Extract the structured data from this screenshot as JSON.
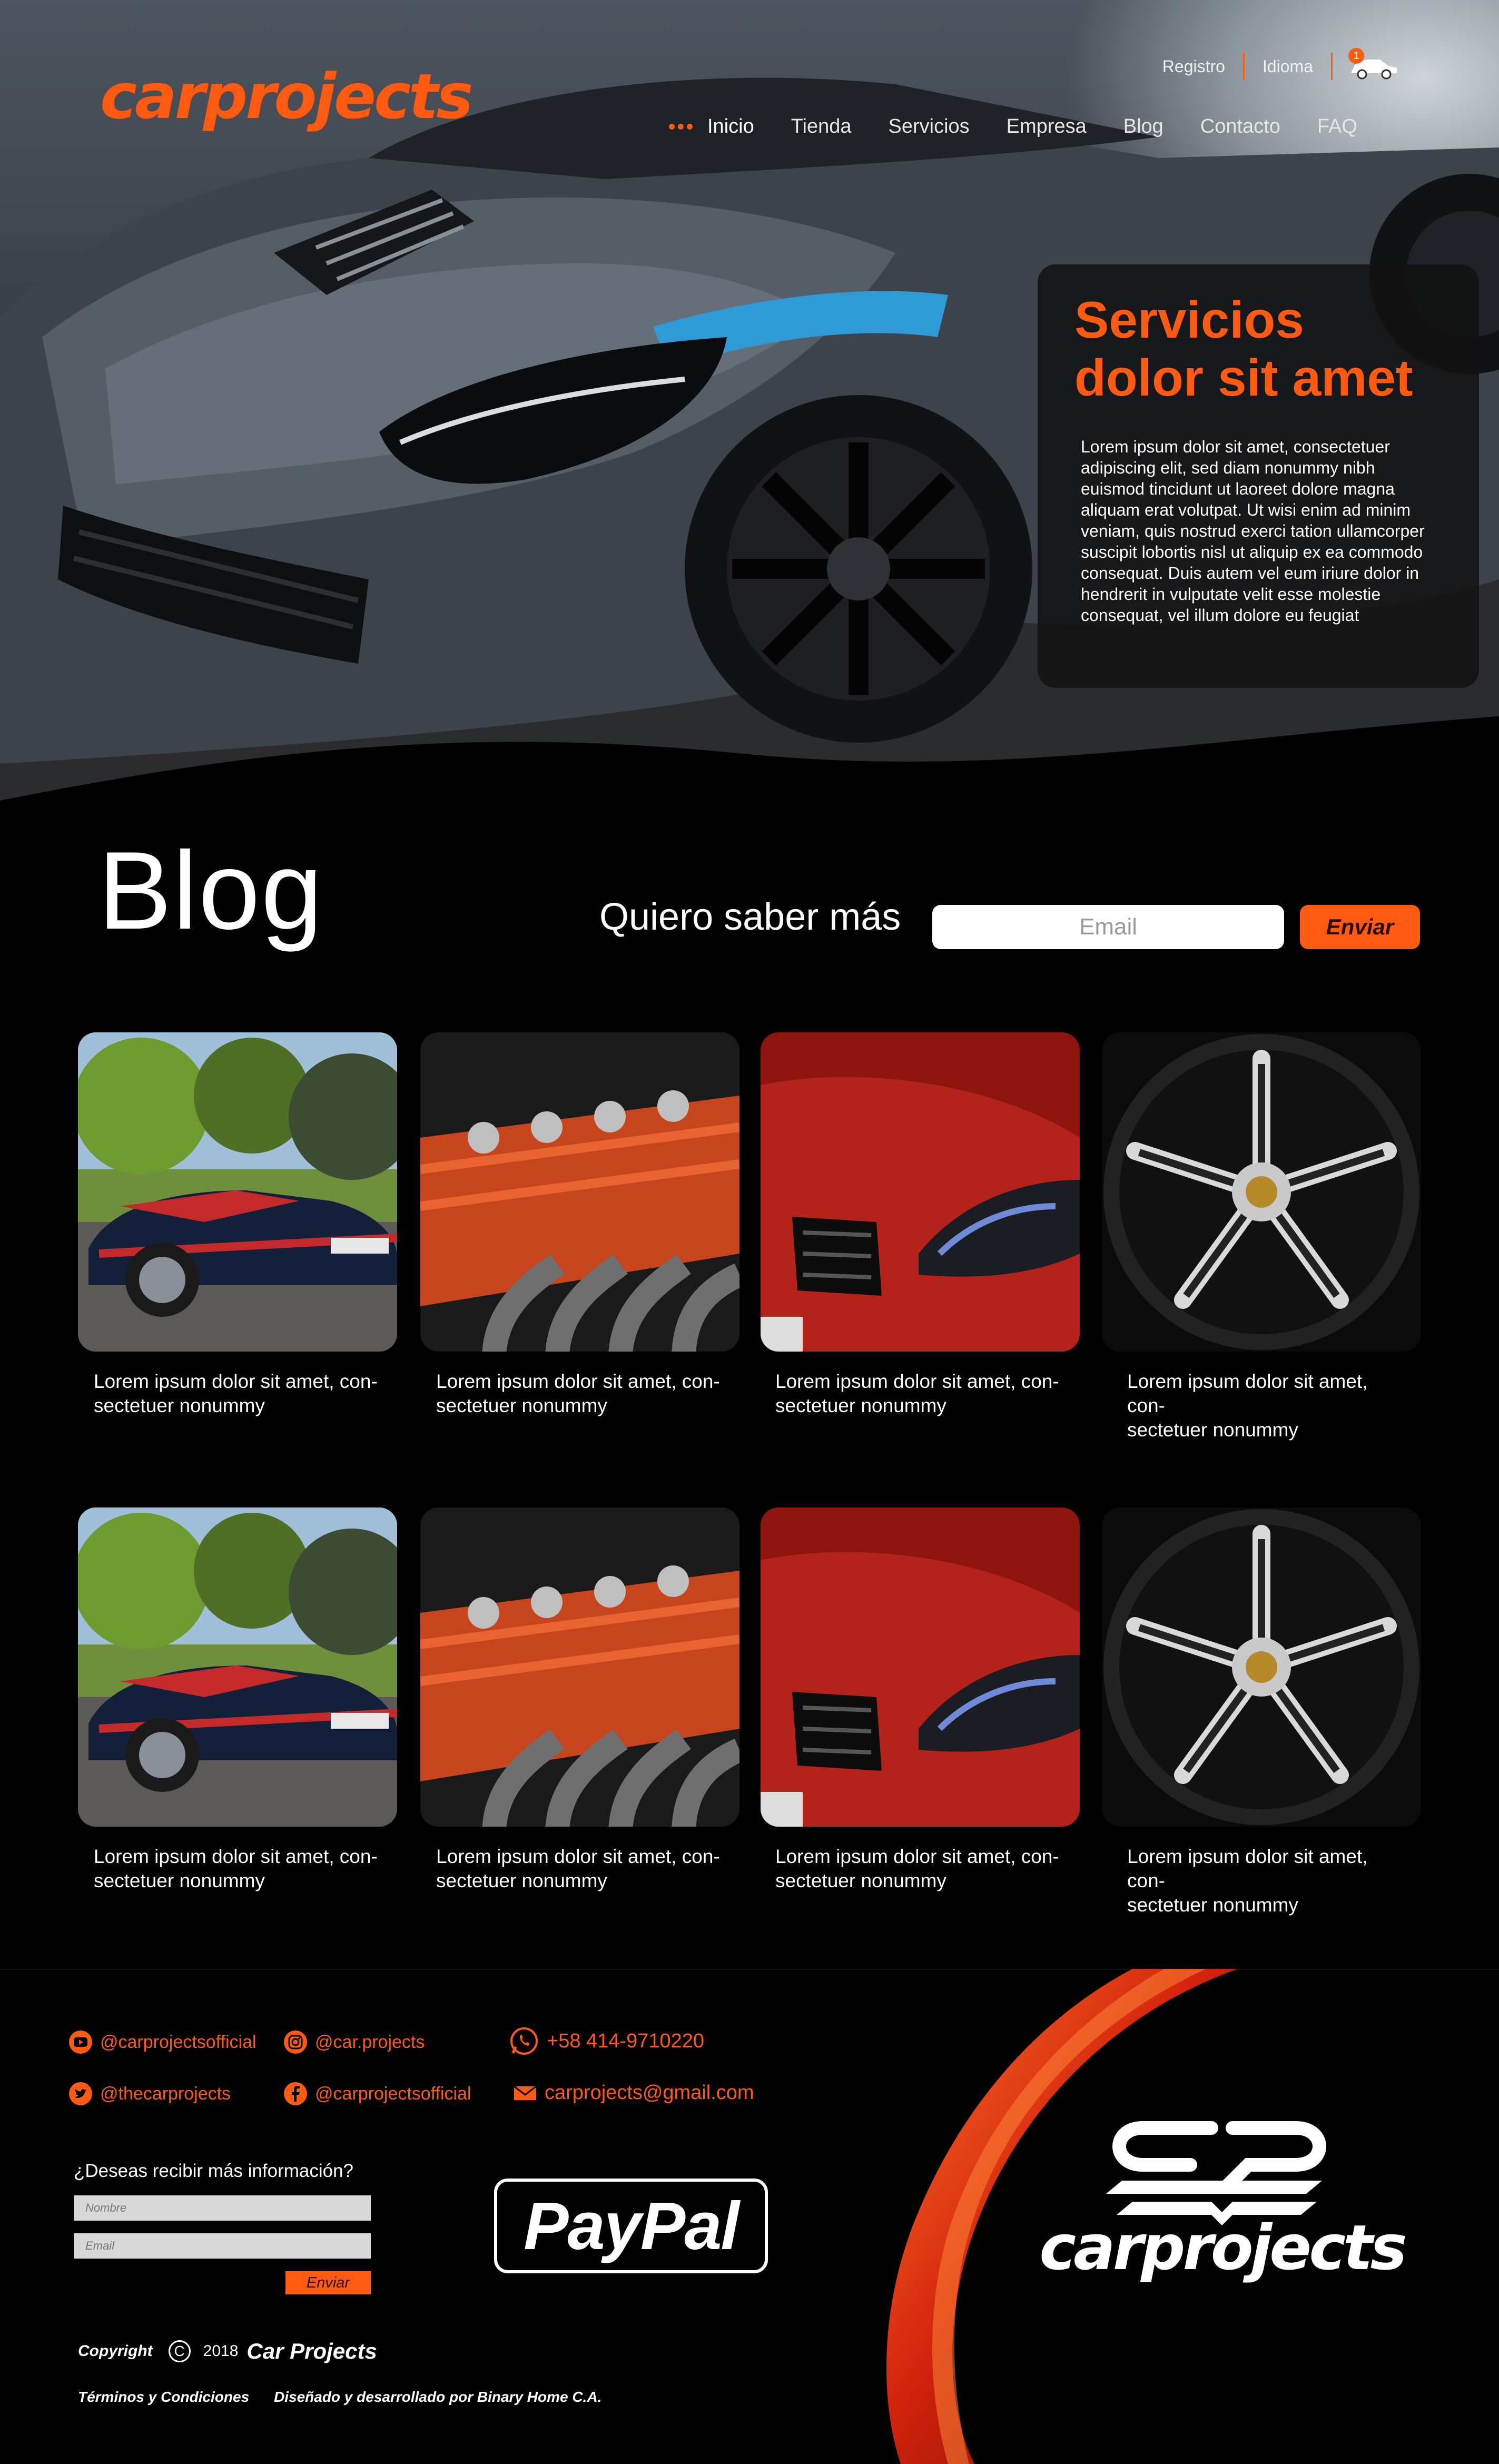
{
  "brand": {
    "logo_text": "carprojects",
    "accent_color": "#ff5a12",
    "background_color": "#000000"
  },
  "top_bar": {
    "links": [
      "Registro",
      "Idioma"
    ],
    "cart_count": "1",
    "cart_icon": "car-cart-icon"
  },
  "nav": {
    "items": [
      "Inicio",
      "Tienda",
      "Servicios",
      "Empresa",
      "Blog",
      "Contacto",
      "FAQ"
    ],
    "active": "Inicio"
  },
  "hero": {
    "title_line1": "Servicios",
    "title_line2": "dolor sit amet",
    "body": "Lorem ipsum dolor sit amet, consectetuer adipiscing elit, sed diam nonummy nibh euismod tincidunt ut laoreet dolore magna aliquam erat volutpat. Ut wisi enim ad minim veniam, quis nostrud exerci tation ullamcorper suscipit lobortis nisl ut aliquip ex ea commodo consequat. Duis autem vel eum iriure dolor in hendrerit in vulputate velit esse molestie consequat, vel illum dolore eu feugiat"
  },
  "blog": {
    "title": "Blog",
    "subscribe_label": "Quiero saber más",
    "email_placeholder": "Email",
    "send_label": "Enviar",
    "posts": [
      {
        "image": "mustang-photo",
        "caption_line1": "Lorem ipsum dolor sit amet, con-",
        "caption_line2": "sectetuer nonummy"
      },
      {
        "image": "engine-photo",
        "caption_line1": "Lorem ipsum dolor sit amet, con-",
        "caption_line2": "sectetuer nonummy"
      },
      {
        "image": "red-car-headlight-photo",
        "caption_line1": "Lorem ipsum dolor sit amet, con-",
        "caption_line2": "sectetuer nonummy"
      },
      {
        "image": "wheel-rim-photo",
        "caption_line1": "Lorem ipsum dolor sit amet, con-",
        "caption_line2": "sectetuer nonummy"
      },
      {
        "image": "mustang-photo",
        "caption_line1": "Lorem ipsum dolor sit amet, con-",
        "caption_line2": "sectetuer nonummy"
      },
      {
        "image": "engine-photo",
        "caption_line1": "Lorem ipsum dolor sit amet, con-",
        "caption_line2": "sectetuer nonummy"
      },
      {
        "image": "red-car-headlight-photo",
        "caption_line1": "Lorem ipsum dolor sit amet, con-",
        "caption_line2": "sectetuer nonummy"
      },
      {
        "image": "wheel-rim-photo",
        "caption_line1": "Lorem ipsum dolor sit amet, con-",
        "caption_line2": "sectetuer nonummy"
      }
    ]
  },
  "footer": {
    "social": {
      "youtube": "@carprojectsofficial",
      "instagram": "@car.projects",
      "whatsapp": "+58 414-9710220",
      "twitter": "@thecarprojects",
      "facebook": "@carprojectsofficial",
      "email": "carprojects@gmail.com"
    },
    "info_label": "¿Deseas recibir más información?",
    "name_placeholder": "Nombre",
    "email_placeholder": "Email",
    "send_label": "Enviar",
    "paypal": "PayPal",
    "copyright_label": "Copyright",
    "copyright_symbol": "C",
    "year": "2018",
    "brand_name": "Car Projects",
    "terms": "Términos y Condiciones",
    "credits": "Diseñado y desarrollado por Binary Home C.A.",
    "logo_text": "carprojects"
  }
}
